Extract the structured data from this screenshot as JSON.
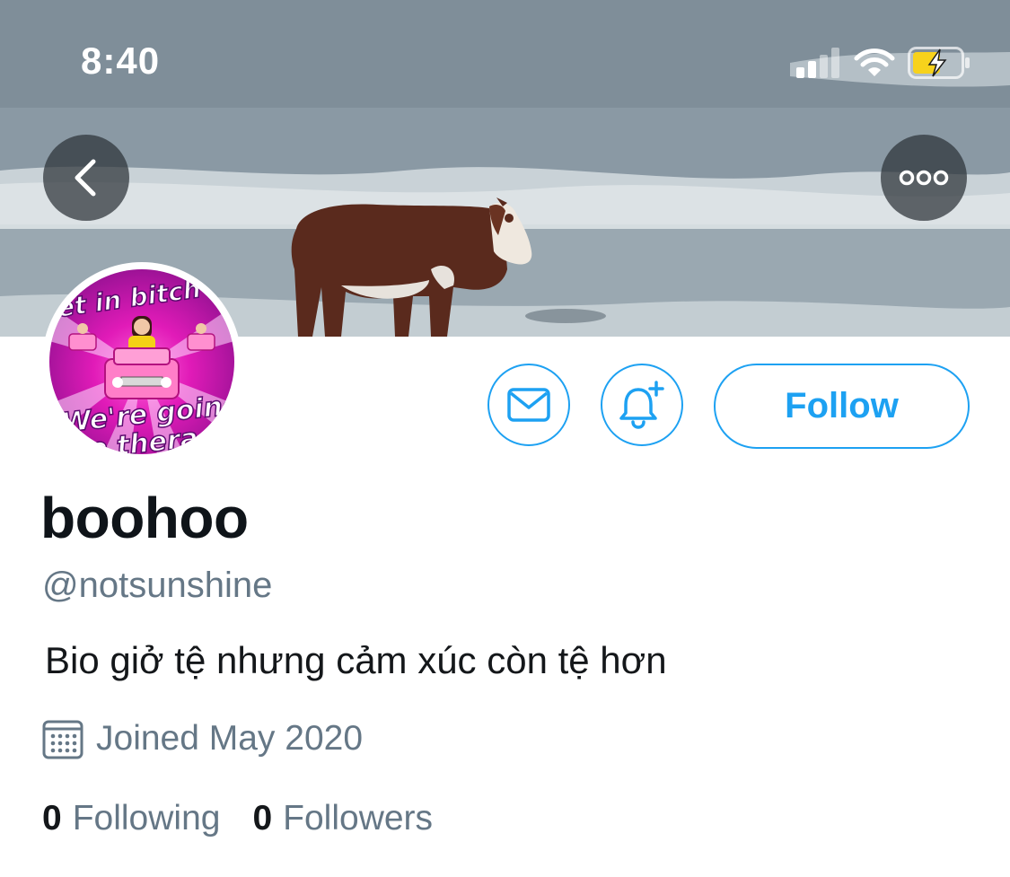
{
  "status_bar": {
    "time": "8:40"
  },
  "header": {
    "banner_icon": "banner-image",
    "back_icon": "chevron-left-icon",
    "more_icon": "more-dots-icon"
  },
  "profile": {
    "avatar_text_top": "et in bitch",
    "avatar_text_bottom": "We're going",
    "avatar_text_bottom2": "to thera",
    "display_name": "boohoo",
    "handle": "@notsunshine",
    "bio": "Bio giở tệ nhưng cảm xúc còn tệ hơn",
    "joined": "Joined May 2020",
    "following_count": "0",
    "following_label": "Following",
    "followers_count": "0",
    "followers_label": "Followers"
  },
  "actions": {
    "follow_label": "Follow",
    "message_icon": "mail-icon",
    "notify_icon": "bell-plus-icon"
  },
  "colors": {
    "accent": "#1da1f2",
    "secondary_text": "#657786",
    "primary_text": "#14171a"
  }
}
